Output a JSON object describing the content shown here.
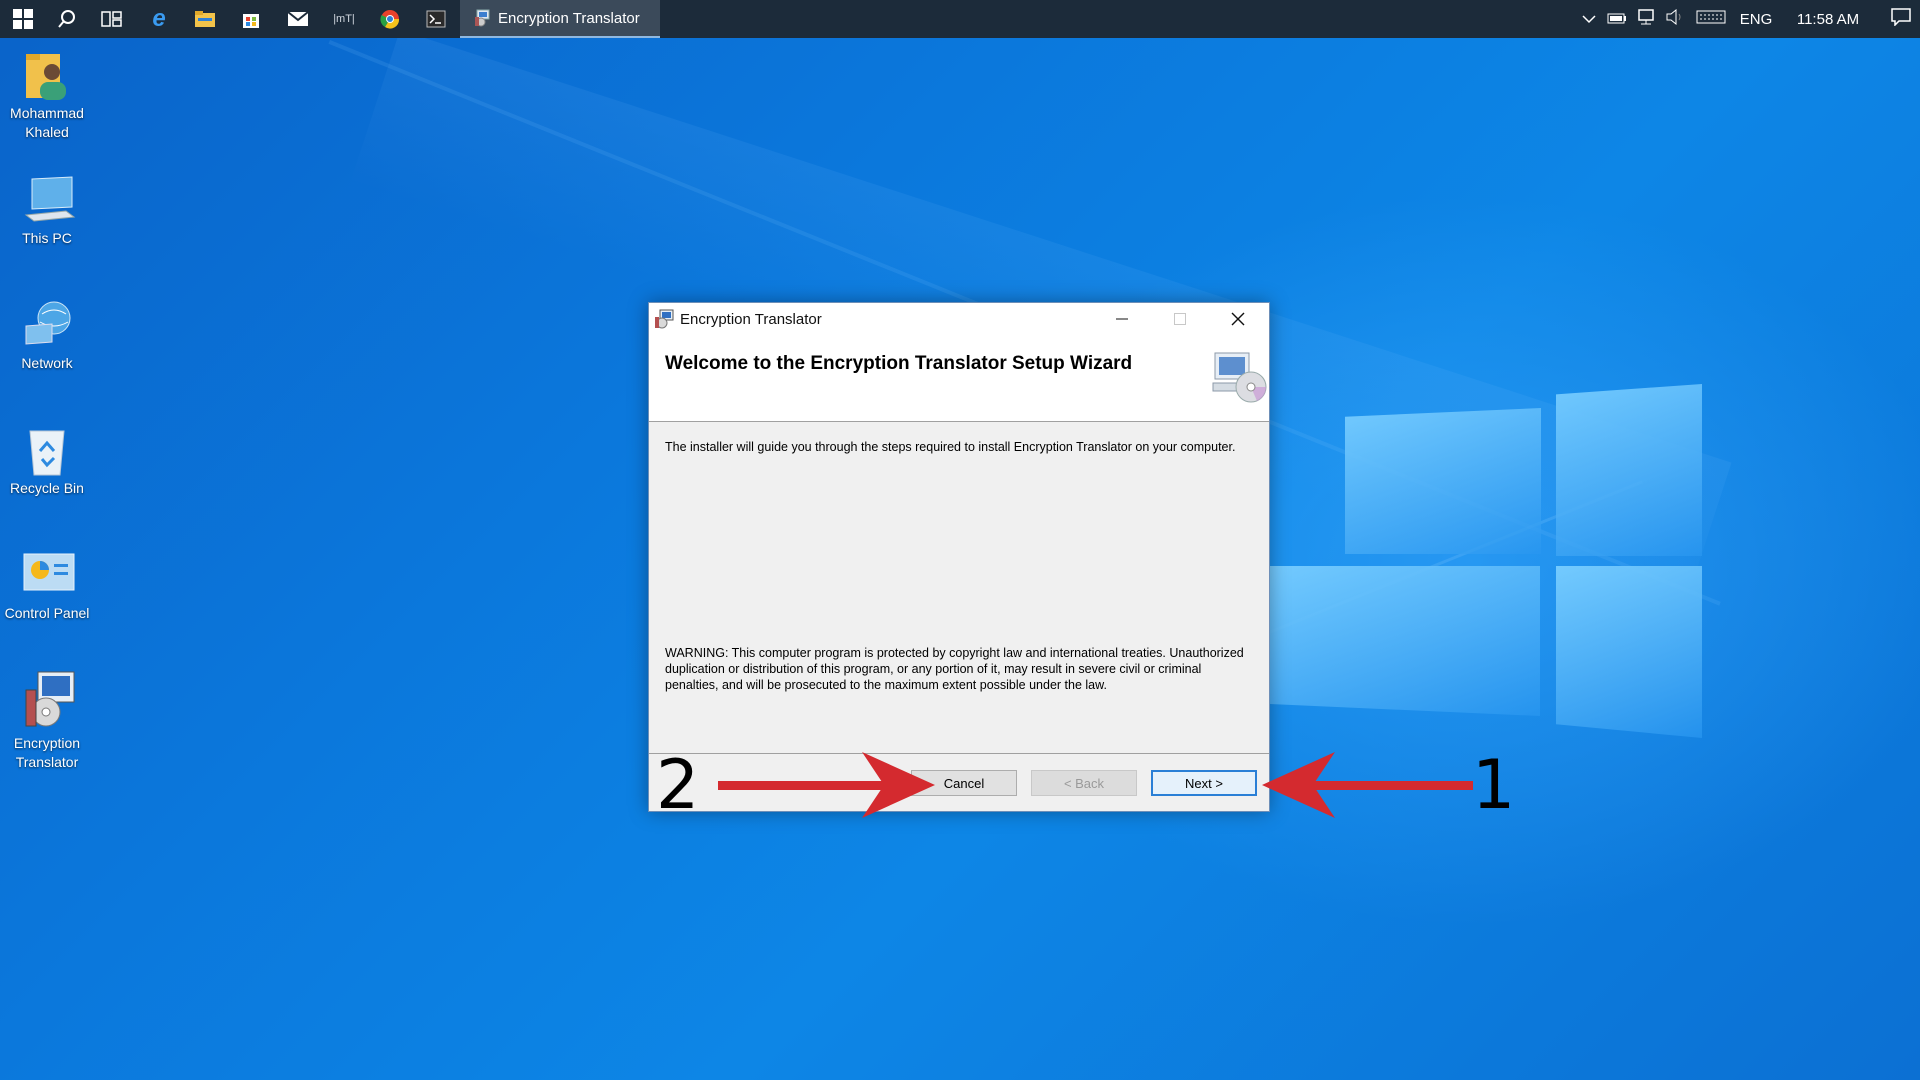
{
  "taskbar": {
    "start_icon": "windows-start-icon",
    "pinned": [
      {
        "name": "search-icon",
        "glyph": "⚲"
      },
      {
        "name": "task-view-icon",
        "glyph": "⧉"
      },
      {
        "name": "edge-icon",
        "glyph": "e"
      },
      {
        "name": "file-explorer-icon",
        "glyph": "▭"
      },
      {
        "name": "store-icon",
        "glyph": "▣"
      },
      {
        "name": "mail-icon",
        "glyph": "✉"
      },
      {
        "name": "mt-icon",
        "glyph": "|mT|"
      },
      {
        "name": "chrome-icon",
        "glyph": "◉"
      },
      {
        "name": "terminal-icon",
        "glyph": ">_"
      }
    ],
    "active_window_label": "Encryption Translator",
    "tray": {
      "language": "ENG",
      "time": "11:58 AM"
    }
  },
  "desktop_icons": [
    {
      "name": "desktop-icon-user-folder",
      "label_line1": "Mohammad",
      "label_line2": "Khaled"
    },
    {
      "name": "desktop-icon-this-pc",
      "label_line1": "This PC",
      "label_line2": ""
    },
    {
      "name": "desktop-icon-network",
      "label_line1": "Network",
      "label_line2": ""
    },
    {
      "name": "desktop-icon-recycle-bin",
      "label_line1": "Recycle Bin",
      "label_line2": ""
    },
    {
      "name": "desktop-icon-control-panel",
      "label_line1": "Control Panel",
      "label_line2": ""
    },
    {
      "name": "desktop-icon-encryption-translator",
      "label_line1": "Encryption",
      "label_line2": "Translator"
    }
  ],
  "dialog": {
    "title": "Encryption Translator",
    "heading": "Welcome to the Encryption Translator Setup Wizard",
    "intro": "The installer will guide you through the steps required to install Encryption Translator on your computer.",
    "warning": "WARNING: This computer program is protected by copyright law and international treaties. Unauthorized duplication or distribution of this program, or any portion of it, may result in severe civil or criminal penalties, and will be prosecuted to the maximum extent possible under the law.",
    "buttons": {
      "cancel": "Cancel",
      "back": "< Back",
      "next": "Next >"
    }
  },
  "annotations": {
    "left_number": "2",
    "right_number": "1",
    "arrow_color": "#d42a2f"
  },
  "colors": {
    "taskbar": "#1c2b3a",
    "desktop_blue": "#0b78dc",
    "default_button_border": "#2a7fd6"
  }
}
